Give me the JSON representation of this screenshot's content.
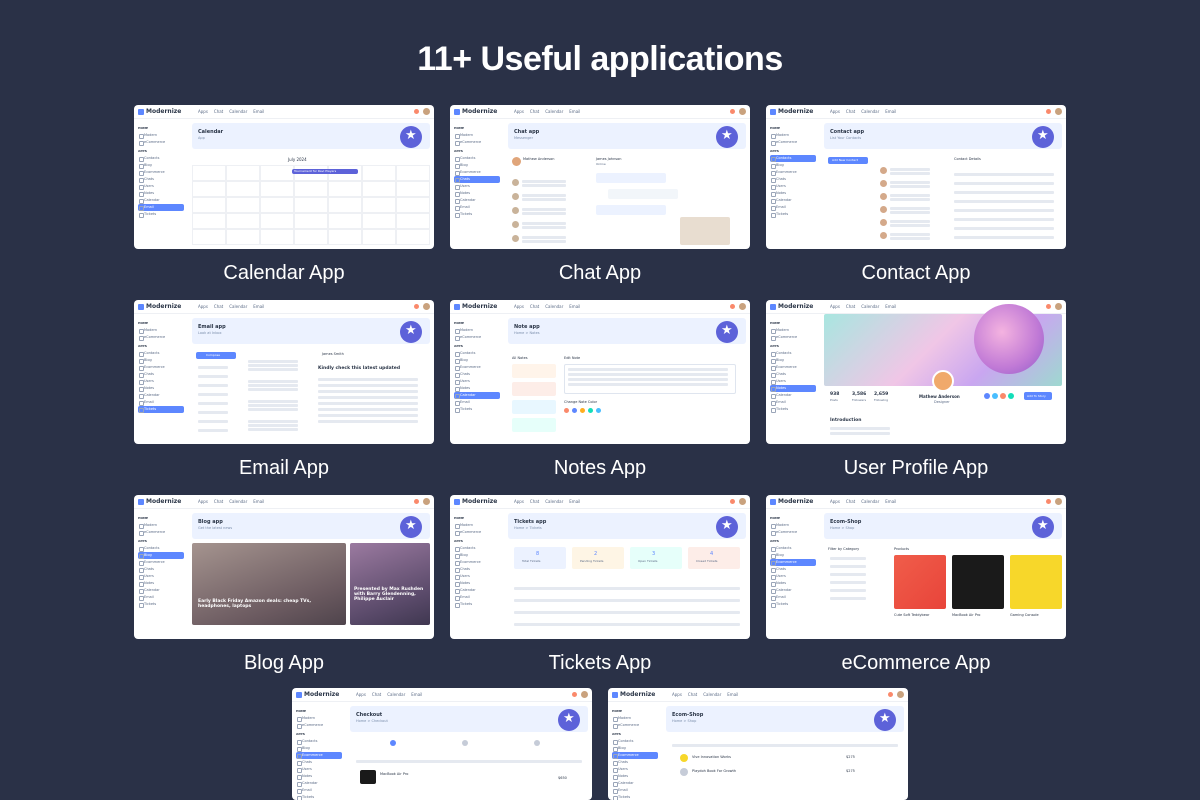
{
  "headline": "11+ Useful applications",
  "brand": "Modernize",
  "nav": [
    "Apps",
    "Chat",
    "Calendar",
    "Email"
  ],
  "sidebar": [
    "Modern",
    "eCommerce",
    "Contacts",
    "Blog",
    "Ecommerce",
    "Chats",
    "Users",
    "Notes",
    "Calendar",
    "Email",
    "Tickets"
  ],
  "apps": [
    {
      "caption": "Calendar App",
      "banner": "Calendar",
      "sub": "App",
      "month": "July 2024",
      "event": "Tournament for Ravi Players"
    },
    {
      "caption": "Chat App",
      "banner": "Chat app",
      "sub": "Messenger",
      "user1": "Mathew Anderson",
      "user2": "James Johnson",
      "status": "Online"
    },
    {
      "caption": "Contact App",
      "banner": "Contact app",
      "sub": "List Your Contacts",
      "details": "Contact Details",
      "add": "Add New Contact"
    },
    {
      "caption": "Email App",
      "banner": "Email app",
      "sub": "Look at Inbox",
      "compose": "Compose",
      "subject": "Kindly check this latest updated",
      "sender": "James Smith"
    },
    {
      "caption": "Notes App",
      "banner": "Note app",
      "sub": "Home > Notes",
      "all": "All Notes",
      "edit": "Edit Note",
      "colors": "Change Note Color"
    },
    {
      "caption": "User Profile App",
      "name": "Mathew Anderson",
      "role": "Designer",
      "stats": [
        "938",
        "3,586",
        "2,659"
      ],
      "stat_labels": [
        "Posts",
        "Followers",
        "Following"
      ],
      "intro": "Introduction",
      "add": "Add To Story"
    },
    {
      "caption": "Blog App",
      "banner": "Blog app",
      "sub": "Get the latest news",
      "post1": "Early Black Friday Amazon deals: cheap TVs, headphones, laptops",
      "post2": "Presented by Max Rushden with Barry Glendenning, Philippe Auclair"
    },
    {
      "caption": "Tickets App",
      "banner": "Tickets app",
      "sub": "Home > Tickets",
      "counts": [
        "8",
        "2",
        "3",
        "4"
      ],
      "count_labels": [
        "Total Tickets",
        "Pending Tickets",
        "Open Tickets",
        "Closed Tickets"
      ]
    },
    {
      "caption": "eCommerce  App",
      "banner": "Ecom-Shop",
      "sub": "Home > Shop",
      "products": "Products",
      "filter": "Filter by Category",
      "items": [
        "Cute Soft Teddybear",
        "MacBook Air Pro",
        "Gaming Console"
      ]
    },
    {
      "caption": "",
      "banner": "Checkout",
      "sub": "Home > Checkout",
      "product": "MacBook Air Pro",
      "price": "$650"
    },
    {
      "caption": "",
      "banner": "Ecom-Shop",
      "sub": "Home > Shop",
      "rows": [
        "Vive Innovation Works",
        "Playdoh Book For Growth"
      ],
      "prices": [
        "$275",
        "$275"
      ]
    }
  ],
  "colors": {
    "bg": "#2a3147",
    "primary": "#5d87ff",
    "light": "#ecf2ff",
    "badge": "#5d62d9"
  }
}
